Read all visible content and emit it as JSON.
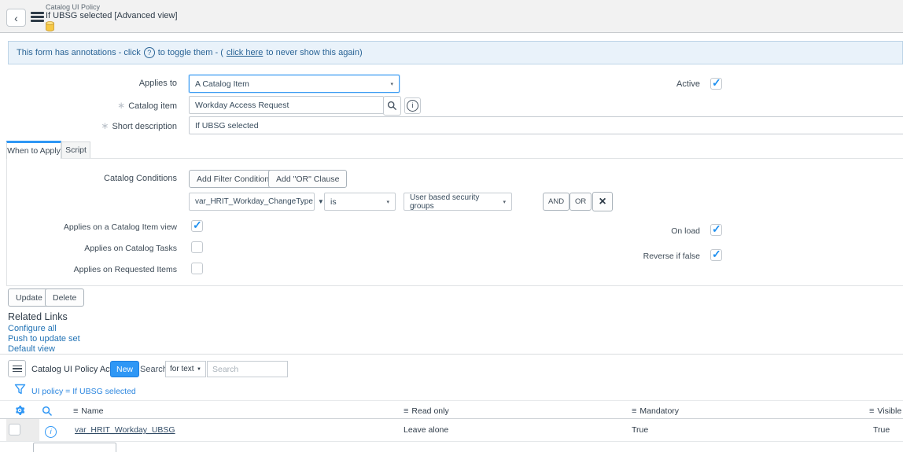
{
  "icons": {
    "back": "‹",
    "question": "?",
    "info": "i",
    "asterisk": "∗",
    "dropdown_small": "▾",
    "dropdown_filled": "▼",
    "column_menu": "≡",
    "close": "×"
  },
  "header": {
    "record_type": "Catalog UI Policy",
    "record_title": "If UBSG selected [Advanced view]"
  },
  "annotation_bar": {
    "before": "This form has annotations - click",
    "middle": "to toggle them - (",
    "link": "click here",
    "after": "to never show this again)"
  },
  "form": {
    "applies_to_label": "Applies to",
    "applies_to_value": "A Catalog Item",
    "active_label": "Active",
    "active_checked": true,
    "catalog_item_label": "Catalog item",
    "catalog_item_value": "Workday Access Request",
    "short_description_label": "Short description",
    "short_description_value": "If UBSG selected",
    "tabs": {
      "when_to_apply": "When to Apply",
      "script": "Script"
    },
    "conditions": {
      "label": "Catalog Conditions",
      "add_filter": "Add Filter Condition",
      "add_or": "Add \"OR\" Clause",
      "field": "var_HRIT_Workday_ChangeType",
      "operator": "is",
      "value": "User based security groups",
      "and": "AND",
      "or": "OR"
    },
    "applies_checkboxes": [
      {
        "label": "Applies on a Catalog Item view",
        "checked": true
      },
      {
        "label": "Applies on Catalog Tasks",
        "checked": false
      },
      {
        "label": "Applies on Requested Items",
        "checked": false
      }
    ],
    "right_checkboxes": [
      {
        "label": "On load",
        "checked": true
      },
      {
        "label": "Reverse if false",
        "checked": true
      }
    ],
    "update": "Update",
    "delete": "Delete"
  },
  "related_links": {
    "title": "Related Links",
    "items": [
      "Configure all",
      "Push to update set",
      "Default view"
    ]
  },
  "list": {
    "title": "Catalog UI Policy Actions",
    "new": "New",
    "search_label": "Search",
    "search_type": "for text",
    "search_placeholder": "Search",
    "filter": "UI policy = If UBSG selected",
    "columns": {
      "name": "Name",
      "read_only": "Read only",
      "mandatory": "Mandatory",
      "visible": "Visible"
    },
    "rows": [
      {
        "name": "var_HRIT_Workday_UBSG",
        "read_only": "Leave alone",
        "mandatory": "True",
        "visible": "True"
      }
    ]
  },
  "colors": {
    "accent_blue": "#2f97f5",
    "link_blue": "#2273b5",
    "filter_blue": "#2b86df",
    "annotation_blue": "#2a6496",
    "db_icon_yellow": "#f6c844"
  }
}
